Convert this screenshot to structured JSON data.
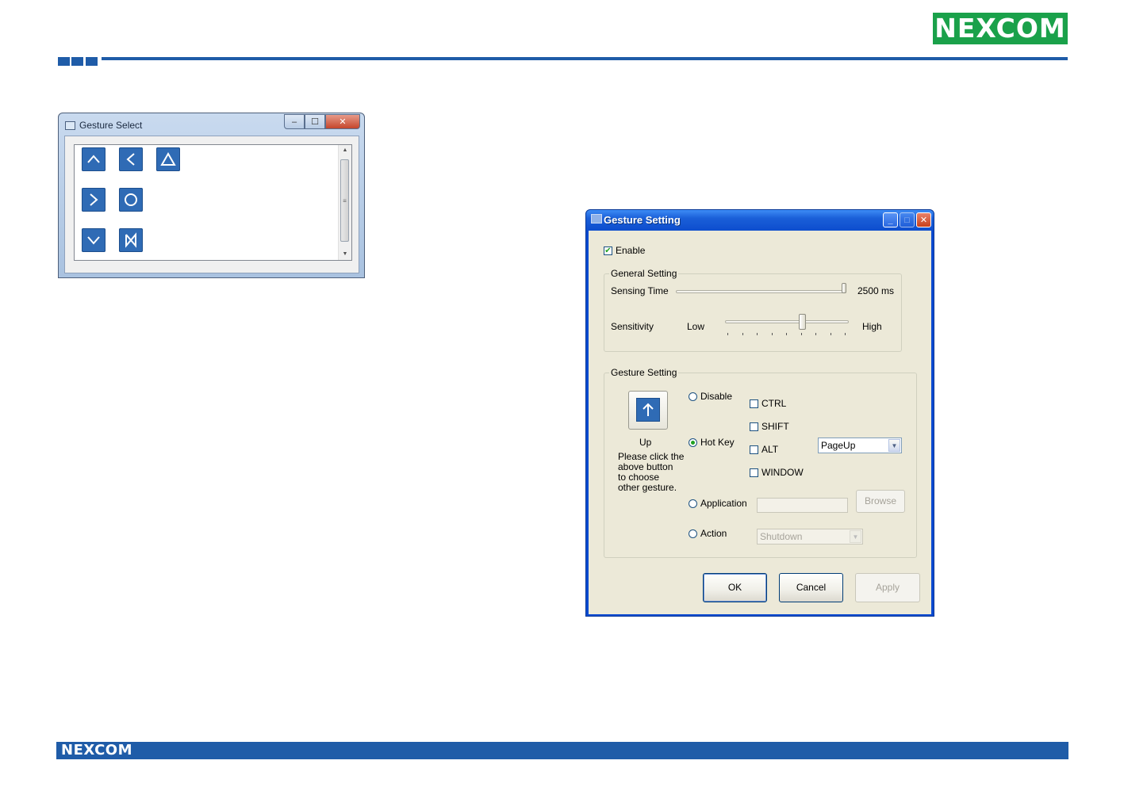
{
  "brand": {
    "name": "NEXCOM",
    "color": "#1aa14a",
    "accent": "#1f5ca8"
  },
  "gesture_select": {
    "title": "Gesture Select",
    "controls": {
      "minimize": "‒",
      "maximize": "☐",
      "close": "✕"
    },
    "gestures": [
      {
        "name": "up",
        "icon": "chevron-up-icon"
      },
      {
        "name": "left",
        "icon": "chevron-left-icon"
      },
      {
        "name": "triangle",
        "icon": "triangle-icon"
      },
      {
        "name": "right",
        "icon": "chevron-right-icon"
      },
      {
        "name": "circle",
        "icon": "circle-icon"
      },
      {
        "name": "down",
        "icon": "chevron-down-icon"
      },
      {
        "name": "cross",
        "icon": "bowtie-icon"
      }
    ]
  },
  "gesture_setting": {
    "title": "Gesture Setting",
    "enable": {
      "label": "Enable",
      "checked": true
    },
    "general": {
      "group_label": "General Setting",
      "sensing_time_label": "Sensing Time",
      "sensing_time_value": "2500 ms",
      "sensing_time_fraction": 1.0,
      "sensitivity_label": "Sensitivity",
      "low_label": "Low",
      "high_label": "High",
      "sensitivity_fraction": 0.62
    },
    "gesture": {
      "group_label": "Gesture Setting",
      "current_gesture": "Up",
      "current_icon": "arrow-up-icon",
      "hint": [
        "Please click the",
        "above button",
        "to choose",
        "other gesture."
      ],
      "disable_label": "Disable",
      "hotkey_label": "Hot Key",
      "application_label": "Application",
      "action_label": "Action",
      "selected_mode": "Hot Key",
      "modifiers": [
        {
          "label": "CTRL",
          "checked": false
        },
        {
          "label": "SHIFT",
          "checked": false
        },
        {
          "label": "ALT",
          "checked": false
        },
        {
          "label": "WINDOW",
          "checked": false
        }
      ],
      "key_value": "PageUp",
      "application_path": "",
      "browse_label": "Browse",
      "action_value": "Shutdown"
    },
    "buttons": {
      "ok": "OK",
      "cancel": "Cancel",
      "apply": "Apply"
    }
  }
}
